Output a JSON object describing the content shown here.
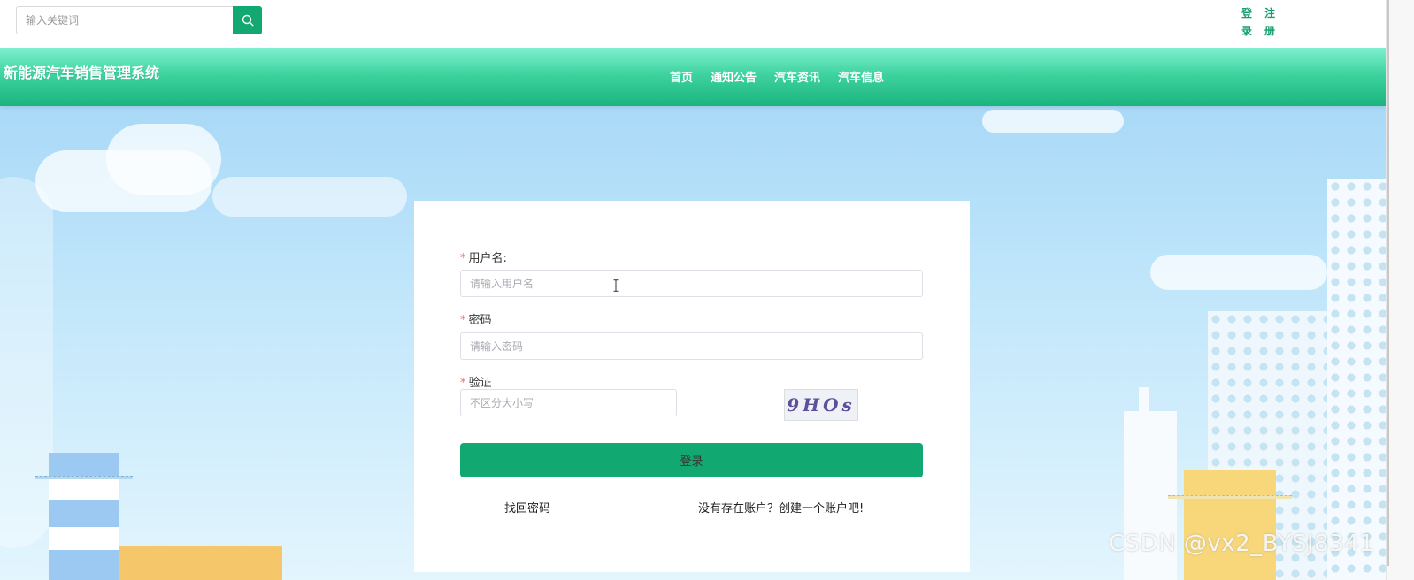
{
  "search": {
    "placeholder": "输入关键词",
    "icon": "search-icon"
  },
  "auth": {
    "login": "登录",
    "register": "注册"
  },
  "header": {
    "site_title": "新能源汽车销售管理系统"
  },
  "nav": {
    "items": [
      "首页",
      "通知公告",
      "汽车资讯",
      "汽车信息"
    ]
  },
  "login_form": {
    "username_label": "用户名:",
    "username_placeholder": "请输入用户名",
    "password_label": "密码",
    "password_placeholder": "请输入密码",
    "captcha_label": "验证",
    "captcha_placeholder": "不区分大小写",
    "captcha_text": "9HOs",
    "required_mark": "*",
    "submit_label": "登录",
    "forgot_link": "找回密码",
    "register_link": "没有存在账户？创建一个账户吧!"
  },
  "watermark": "CSDN @vx2_BYSJ8341",
  "colors": {
    "brand": "#12a872",
    "nav_gradient_top": "#7ff0d0",
    "nav_gradient_bottom": "#1bb47e",
    "required": "#f56c6c"
  }
}
